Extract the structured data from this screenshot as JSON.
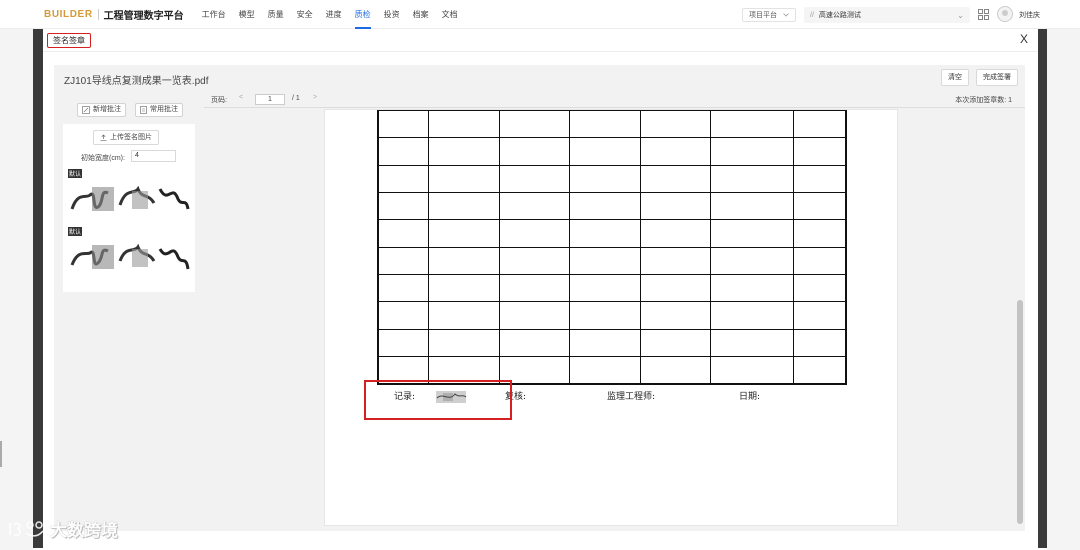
{
  "app": {
    "brand": "BUILDER",
    "name": "工程管理数字平台"
  },
  "nav": [
    {
      "label": "工作台",
      "active": false
    },
    {
      "label": "模型",
      "active": false
    },
    {
      "label": "质量",
      "active": false
    },
    {
      "label": "安全",
      "active": false
    },
    {
      "label": "进度",
      "active": false
    },
    {
      "label": "质检",
      "active": true
    },
    {
      "label": "投资",
      "active": false
    },
    {
      "label": "档案",
      "active": false
    },
    {
      "label": "文档",
      "active": false
    }
  ],
  "header": {
    "platform_select": "项目平台",
    "project_select": "高速公路测试",
    "user_name": "刘佳庆"
  },
  "dialog": {
    "title": "签名签章",
    "close": "X",
    "file_name": "ZJ101导线点复测成果一览表.pdf",
    "clear_button": "清空",
    "finish_button": "完成签署"
  },
  "left_panel": {
    "new_annotation": "新增批注",
    "common_annotation": "常用批注",
    "upload_button": "上传签名图片",
    "width_label": "初始宽度(cm):",
    "width_value": "4",
    "signatures": [
      {
        "tag": "默认"
      },
      {
        "tag": "默认"
      }
    ]
  },
  "viewer": {
    "page_label": "页码:",
    "prev": "<",
    "current_page": "1",
    "total_pages": "/ 1",
    "next": ">",
    "added_count_label": "本次添加签章数: 1"
  },
  "document": {
    "table_rows": 10,
    "table_cols": 7,
    "footer": [
      {
        "label": "记录:"
      },
      {
        "label": "复核:"
      },
      {
        "label": "监理工程师:"
      },
      {
        "label": "日期:"
      }
    ]
  },
  "watermark": "大数跨境",
  "colors": {
    "accent": "#1d6ae5",
    "highlight": "#d42020",
    "brand": "#d49a3a"
  }
}
